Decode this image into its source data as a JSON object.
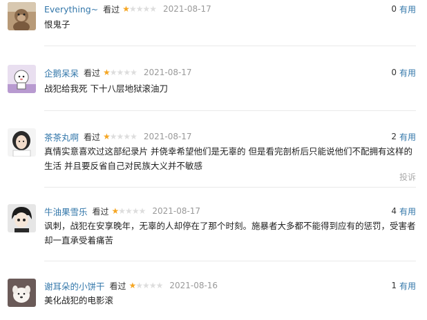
{
  "reviews": [
    {
      "user": "Everything~",
      "status": "看过",
      "rating": 1,
      "date": "2021-08-17",
      "useful_count": "0",
      "useful_label": "有用",
      "text": "恨鬼子",
      "avatar": "monkey-photo"
    },
    {
      "user": "企鹅呆呆",
      "status": "看过",
      "rating": 1,
      "date": "2021-08-17",
      "useful_count": "0",
      "useful_label": "有用",
      "text": "战犯给我死 下十八层地狱滚油刀",
      "avatar": "cartoon-figure"
    },
    {
      "user": "茶茶丸啊",
      "status": "看过",
      "rating": 1,
      "date": "2021-08-17",
      "useful_count": "2",
      "useful_label": "有用",
      "text": "真情实意喜欢过这部纪录片 并侥幸希望他们是无辜的 但是看完剖析后只能说他们不配拥有这样的生活 并且要反省自己对民族大义并不敏感",
      "report_label": "投诉",
      "avatar": "girl-portrait"
    },
    {
      "user": "牛油果雪乐",
      "status": "看过",
      "rating": 1,
      "date": "2021-08-17",
      "useful_count": "4",
      "useful_label": "有用",
      "text": "讽刺，战犯在安享晚年，无辜的人却停在了那个时刻。施暴者大多都不能得到应有的惩罚，受害者却一直承受着痛苦",
      "avatar": "anime-boy"
    },
    {
      "user": "谢耳朵的小饼干",
      "status": "看过",
      "rating": 1,
      "date": "2021-08-16",
      "useful_count": "1",
      "useful_label": "有用",
      "text": "美化战犯的电影滚",
      "avatar": "white-dog"
    }
  ],
  "colors": {
    "link": "#3377aa",
    "star": "#f5a623",
    "date": "#999999"
  }
}
